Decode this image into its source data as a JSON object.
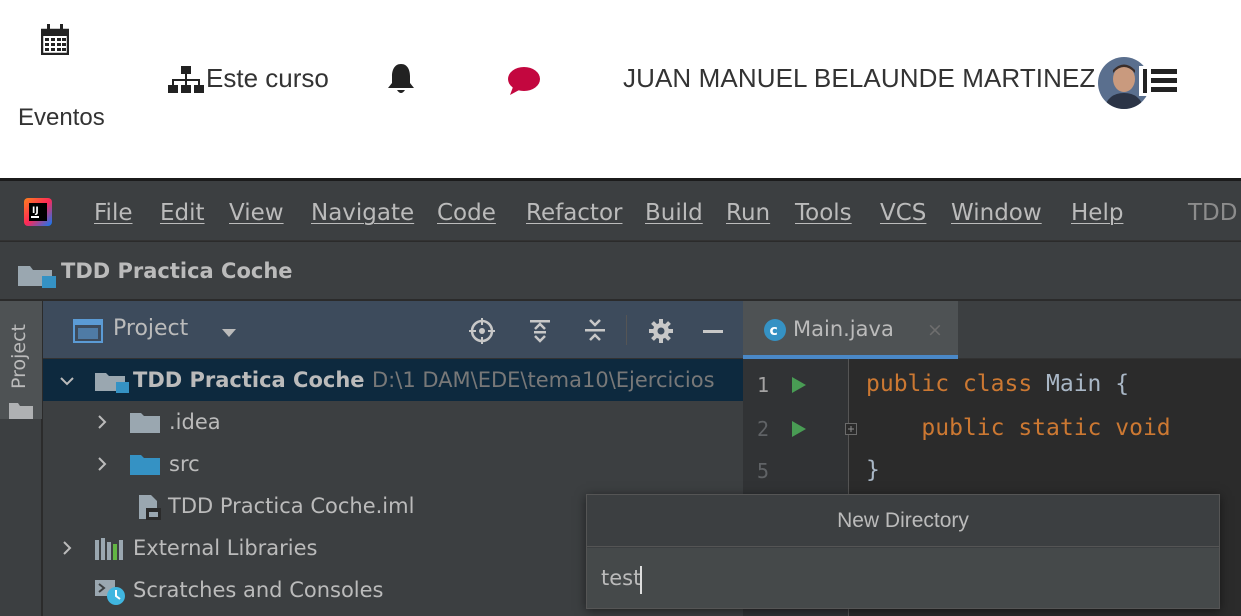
{
  "moodle": {
    "events_label": "Eventos",
    "course_label": "Este curso",
    "user_name": "JUAN MANUEL BELAUNDE MARTINEZ",
    "icons": {
      "calendar": "calendar-icon",
      "course": "sitemap-icon",
      "notifications": "bell-icon",
      "messages": "comment-icon",
      "user_menu": "menu-icon"
    },
    "colors": {
      "message_icon": "#c3073f",
      "text": "#333333"
    }
  },
  "ide": {
    "menu": [
      "File",
      "Edit",
      "View",
      "Navigate",
      "Code",
      "Refactor",
      "Build",
      "Run",
      "Tools",
      "VCS",
      "Window",
      "Help"
    ],
    "window_title": "TDD",
    "navbar_title": "TDD Practica Coche",
    "side_tab": "Project",
    "project_panel": {
      "view_label": "Project",
      "toolbar_icons": [
        "locate-icon",
        "expand-all-icon",
        "collapse-all-icon",
        "gear-icon",
        "minimize-icon"
      ]
    },
    "tree": [
      {
        "label": "TDD Practica Coche",
        "path": "D:\\1 DAM\\EDE\\tema10\\Ejercicios",
        "expanded": true,
        "selected": true,
        "icon": "module-folder-icon"
      },
      {
        "label": ".idea",
        "expanded": false,
        "icon": "folder-icon"
      },
      {
        "label": "src",
        "expanded": false,
        "icon": "source-folder-icon"
      },
      {
        "label": "TDD Practica Coche.iml",
        "icon": "iml-file-icon"
      },
      {
        "label": "External Libraries",
        "expanded": false,
        "icon": "libraries-icon"
      },
      {
        "label": "Scratches and Consoles",
        "icon": "scratches-icon"
      }
    ],
    "editor": {
      "tab_label": "Main.java",
      "tab_close": "×",
      "lines": [
        {
          "num": "1",
          "runnable": true,
          "kw": "public class ",
          "rest": "Main {"
        },
        {
          "num": "2",
          "runnable": true,
          "kw": "    public static void",
          "rest": ""
        },
        {
          "num": "5",
          "runnable": false,
          "kw": "",
          "rest": "}"
        }
      ]
    },
    "new_directory": {
      "title": "New Directory",
      "value": "test"
    },
    "colors": {
      "background": "#2b2b2b",
      "panel": "#3c3f41",
      "selection": "#0d293e",
      "keyword": "#cc7832",
      "run": "#499c54",
      "accent": "#4a88c7"
    }
  }
}
